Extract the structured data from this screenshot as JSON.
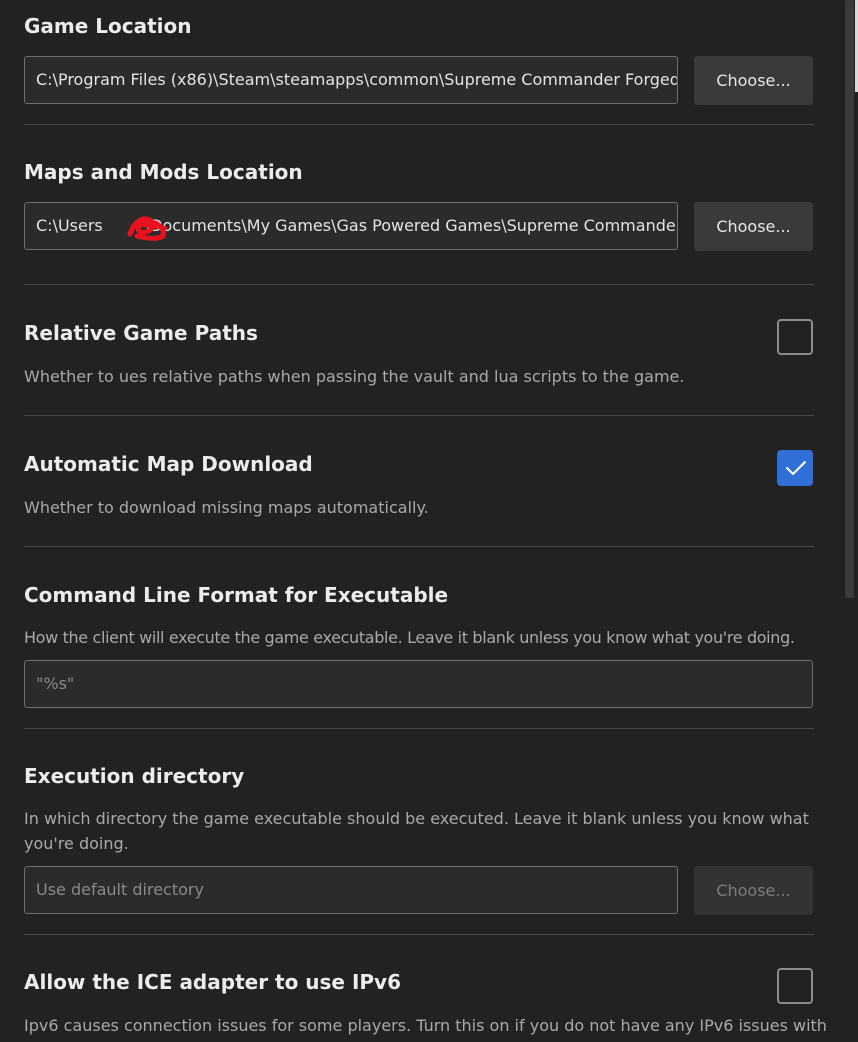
{
  "sections": {
    "game_location": {
      "title": "Game Location",
      "value": "C:\\Program Files (x86)\\Steam\\steamapps\\common\\Supreme Commander Forged Alliance",
      "button_label": "Choose..."
    },
    "maps_mods_location": {
      "title": "Maps and Mods Location",
      "value_prefix": "C:\\Users",
      "value_suffix": "\\Documents\\My Games\\Gas Powered Games\\Supreme Commander Forged Alliance",
      "button_label": "Choose..."
    },
    "relative_paths": {
      "title": "Relative Game Paths",
      "description": "Whether to ues relative paths when passing the vault and lua scripts to the game.",
      "checked": false
    },
    "auto_map_download": {
      "title": "Automatic Map Download",
      "description": "Whether to download missing maps automatically.",
      "checked": true
    },
    "command_line_format": {
      "title": "Command Line Format for Executable",
      "description": "How the client will execute the game executable. Leave it blank unless you know what you're doing.",
      "placeholder": "\"%s\""
    },
    "execution_directory": {
      "title": "Execution directory",
      "description": "In which directory the game executable should be executed. Leave it blank unless you know what you're doing.",
      "placeholder": "Use default directory",
      "button_label": "Choose..."
    },
    "ice_ipv6": {
      "title": "Allow the ICE adapter to use IPv6",
      "description": "Ipv6 causes connection issues for some players. Turn this on if you do not have any IPv6 issues with",
      "checked": false
    }
  },
  "colors": {
    "background": "#222222",
    "accent": "#2f6fd6",
    "redaction": "#e8121e"
  },
  "icons": {
    "check": "checkmark-icon"
  }
}
